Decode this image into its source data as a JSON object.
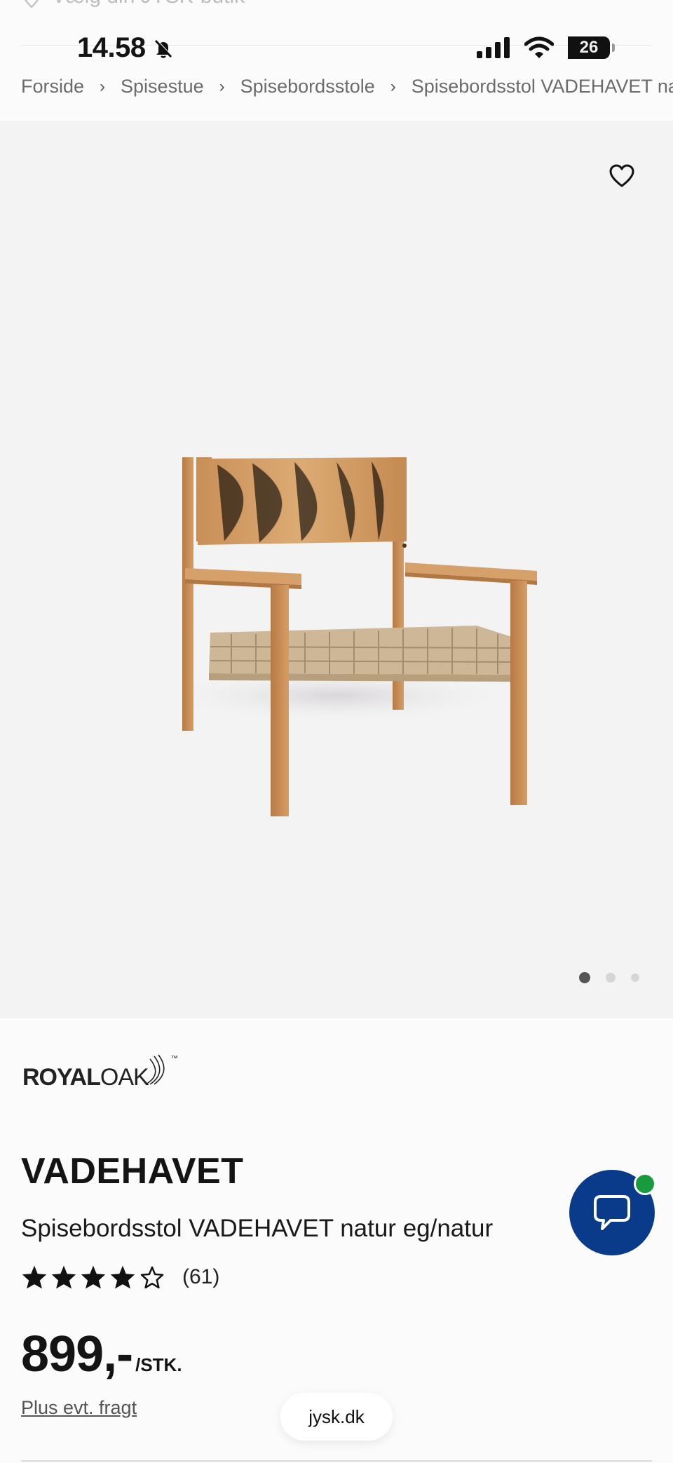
{
  "status_bar": {
    "time": "14.58",
    "battery": "26",
    "faded_store_text": "Vælg din JYSK-butik"
  },
  "breadcrumb": [
    "Forside",
    "Spisestue",
    "Spisebordsstole",
    "Spisebordsstol VADEHAVET natur eg/natur"
  ],
  "gallery": {
    "image_count": 3,
    "active_index": 0
  },
  "brand": {
    "part1": "ROYAL",
    "part2": "OAK",
    "tm": "™"
  },
  "product": {
    "title": "VADEHAVET",
    "subtitle": "Spisebordsstol VADEHAVET natur eg/natur",
    "rating": 4,
    "rating_max": 5,
    "rating_count": "(61)",
    "price": "899,-",
    "price_unit": "/STK.",
    "shipping_note": "Plus evt. fragt"
  },
  "browser": {
    "url": "jysk.dk"
  },
  "colors": {
    "chat_button": "#0a3a8a",
    "online_dot": "#1a9a3e",
    "hero_bg": "#f4f3f4"
  }
}
